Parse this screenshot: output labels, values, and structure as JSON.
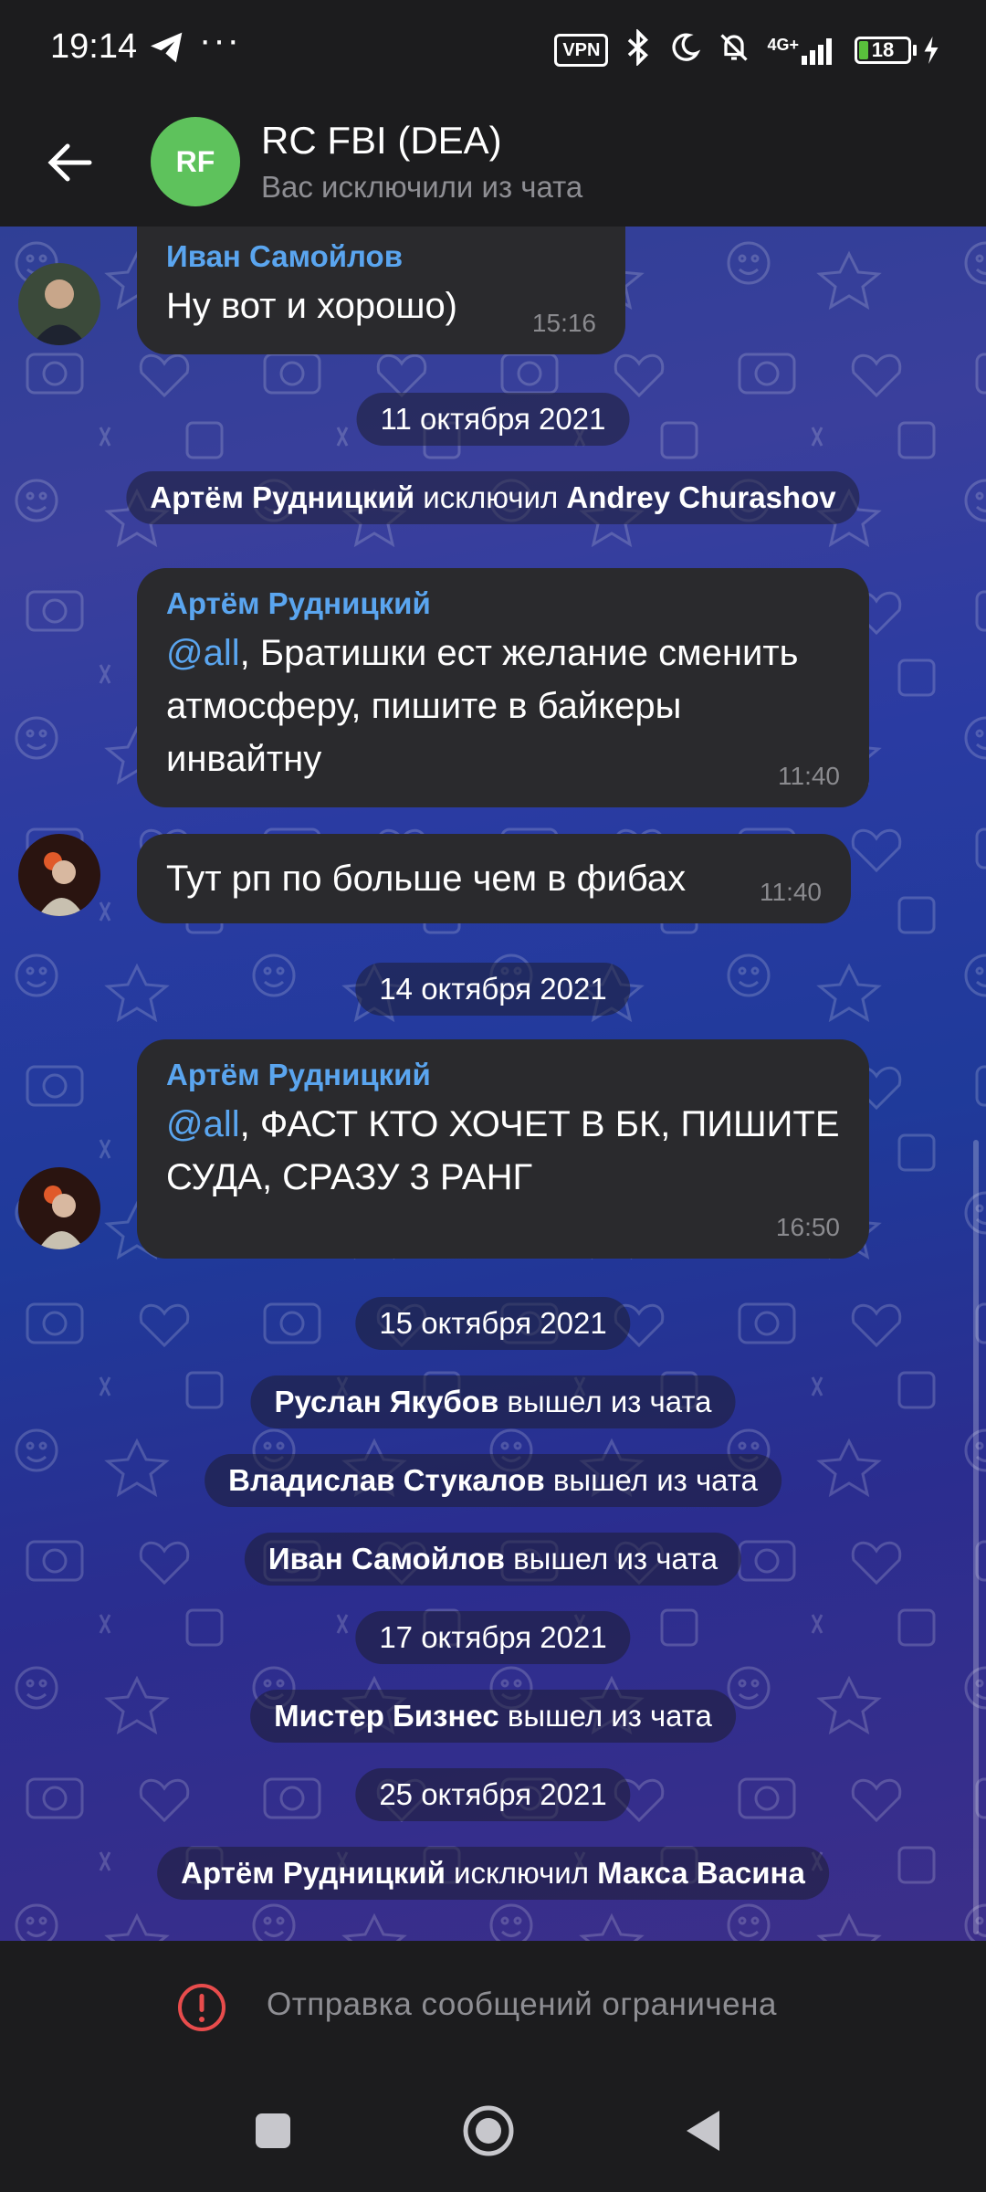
{
  "status_bar": {
    "time": "19:14",
    "dots": "···",
    "vpn": "VPN",
    "network": "4G+",
    "battery": "18"
  },
  "header": {
    "avatar_initials": "RF",
    "title": "RC FBI (DEA)",
    "subtitle": "Вас исключили из чата"
  },
  "messages": {
    "m1": {
      "sender": "Иван Самойлов",
      "text": "Ну вот и хорошо)",
      "time": "15:16"
    },
    "d1": "11 октября 2021",
    "s1": {
      "actor": "Артём Рудницкий",
      "verb": "исключил",
      "target": "Andrey Churashov"
    },
    "m2": {
      "sender": "Артём Рудницкий",
      "mention": "@all",
      "text": ", Братишки ест желание сменить атмосферу, пишите в байкеры инвайтну",
      "time": "11:40"
    },
    "m3": {
      "text": "Тут рп по больше чем в фибах",
      "time": "11:40"
    },
    "d2": "14 октября 2021",
    "m4": {
      "sender": "Артём Рудницкий",
      "mention": "@all",
      "text": ", ФАСТ КТО ХОЧЕТ В БК, ПИШИТЕ СУДА, СРАЗУ 3 РАНГ",
      "time": "16:50"
    },
    "d3": "15 октября 2021",
    "s2": {
      "actor": "Руслан Якубов",
      "verb": "вышел из чата"
    },
    "s3": {
      "actor": "Владислав Стукалов",
      "verb": "вышел из чата"
    },
    "s4": {
      "actor": "Иван Самойлов",
      "verb": "вышел из чата"
    },
    "d4": "17 октября 2021",
    "s5": {
      "actor": "Мистер Бизнес",
      "verb": "вышел из чата"
    },
    "d5": "25 октября 2021",
    "s6": {
      "actor": "Артём Рудницкий",
      "verb": "исключил",
      "target": "Макса Васина"
    }
  },
  "bottom": {
    "restriction_text": "Отправка сообщений ограничена"
  },
  "colors": {
    "accent": "#5aa5ef",
    "avatar_green": "#5ec25c",
    "warning_red": "#e84c4c"
  }
}
